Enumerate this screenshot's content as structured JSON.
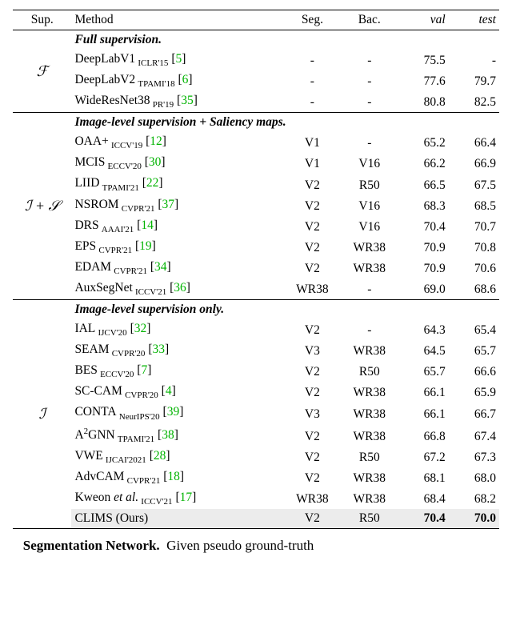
{
  "headers": {
    "sup": "Sup.",
    "method": "Method",
    "seg": "Seg.",
    "bac": "Bac.",
    "val": "val",
    "test": "test"
  },
  "groups": [
    {
      "sup_symbol": "ℱ",
      "title": "Full supervision.",
      "rows": [
        {
          "method": "DeepLabV1",
          "venue": "ICLR'15",
          "ref": "5",
          "seg": "-",
          "bac": "-",
          "val": "75.5",
          "test": "-"
        },
        {
          "method": "DeepLabV2",
          "venue": "TPAMI'18",
          "ref": "6",
          "seg": "-",
          "bac": "-",
          "val": "77.6",
          "test": "79.7"
        },
        {
          "method": "WideResNet38",
          "venue": "PR'19",
          "ref": "35",
          "seg": "-",
          "bac": "-",
          "val": "80.8",
          "test": "82.5"
        }
      ]
    },
    {
      "sup_symbol": "ℐ + 𝒮",
      "title": "Image-level supervision + Saliency maps.",
      "rows": [
        {
          "method": "OAA+",
          "venue": "ICCV'19",
          "ref": "12",
          "seg": "V1",
          "bac": "-",
          "val": "65.2",
          "test": "66.4"
        },
        {
          "method": "MCIS",
          "venue": "ECCV'20",
          "ref": "30",
          "seg": "V1",
          "bac": "V16",
          "val": "66.2",
          "test": "66.9"
        },
        {
          "method": "LIID",
          "venue": "TPAMI'21",
          "ref": "22",
          "seg": "V2",
          "bac": "R50",
          "val": "66.5",
          "test": "67.5"
        },
        {
          "method": "NSROM",
          "venue": "CVPR'21",
          "ref": "37",
          "seg": "V2",
          "bac": "V16",
          "val": "68.3",
          "test": "68.5"
        },
        {
          "method": "DRS",
          "venue": "AAAI'21",
          "ref": "14",
          "seg": "V2",
          "bac": "V16",
          "val": "70.4",
          "test": "70.7"
        },
        {
          "method": "EPS",
          "venue": "CVPR'21",
          "ref": "19",
          "seg": "V2",
          "bac": "WR38",
          "val": "70.9",
          "test": "70.8"
        },
        {
          "method": "EDAM",
          "venue": "CVPR'21",
          "ref": "34",
          "seg": "V2",
          "bac": "WR38",
          "val": "70.9",
          "test": "70.6"
        },
        {
          "method": "AuxSegNet",
          "venue": "ICCV'21",
          "ref": "36",
          "seg": "WR38",
          "bac": "-",
          "val": "69.0",
          "test": "68.6"
        }
      ]
    },
    {
      "sup_symbol": "ℐ",
      "title": "Image-level supervision only.",
      "rows": [
        {
          "method": "IAL",
          "venue": "IJCV'20",
          "ref": "32",
          "seg": "V2",
          "bac": "-",
          "val": "64.3",
          "test": "65.4"
        },
        {
          "method": "SEAM",
          "venue": "CVPR'20",
          "ref": "33",
          "seg": "V3",
          "bac": "WR38",
          "val": "64.5",
          "test": "65.7"
        },
        {
          "method": "BES",
          "venue": "ECCV'20",
          "ref": "7",
          "seg": "V2",
          "bac": "R50",
          "val": "65.7",
          "test": "66.6"
        },
        {
          "method": "SC-CAM",
          "venue": "CVPR'20",
          "ref": "4",
          "seg": "V2",
          "bac": "WR38",
          "val": "66.1",
          "test": "65.9"
        },
        {
          "method": "CONTA",
          "venue": "NeurIPS'20",
          "ref": "39",
          "seg": "V3",
          "bac": "WR38",
          "val": "66.1",
          "test": "66.7"
        },
        {
          "method_html": "A<span class='super'>2</span>GNN",
          "venue": "TPAMI'21",
          "ref": "38",
          "seg": "V2",
          "bac": "WR38",
          "val": "66.8",
          "test": "67.4"
        },
        {
          "method": "VWE",
          "venue": "IJCAI'2021",
          "ref": "28",
          "seg": "V2",
          "bac": "R50",
          "val": "67.2",
          "test": "67.3"
        },
        {
          "method": "AdvCAM",
          "venue": "CVPR'21",
          "ref": "18",
          "seg": "V2",
          "bac": "WR38",
          "val": "68.1",
          "test": "68.0"
        },
        {
          "method_html": "Kweon <i>et al.</i>",
          "venue": "ICCV'21",
          "ref": "17",
          "seg": "WR38",
          "bac": "WR38",
          "val": "68.4",
          "test": "68.2"
        },
        {
          "method": "CLIMS (Ours)",
          "venue": "",
          "ref": "",
          "seg": "V2",
          "bac": "R50",
          "val": "70.4",
          "test": "70.0",
          "highlight": true,
          "bold_vals": true
        }
      ]
    }
  ],
  "caption": {
    "lead": "Segmentation Network.",
    "line1_tail": "Given pseudo ground-truth"
  }
}
